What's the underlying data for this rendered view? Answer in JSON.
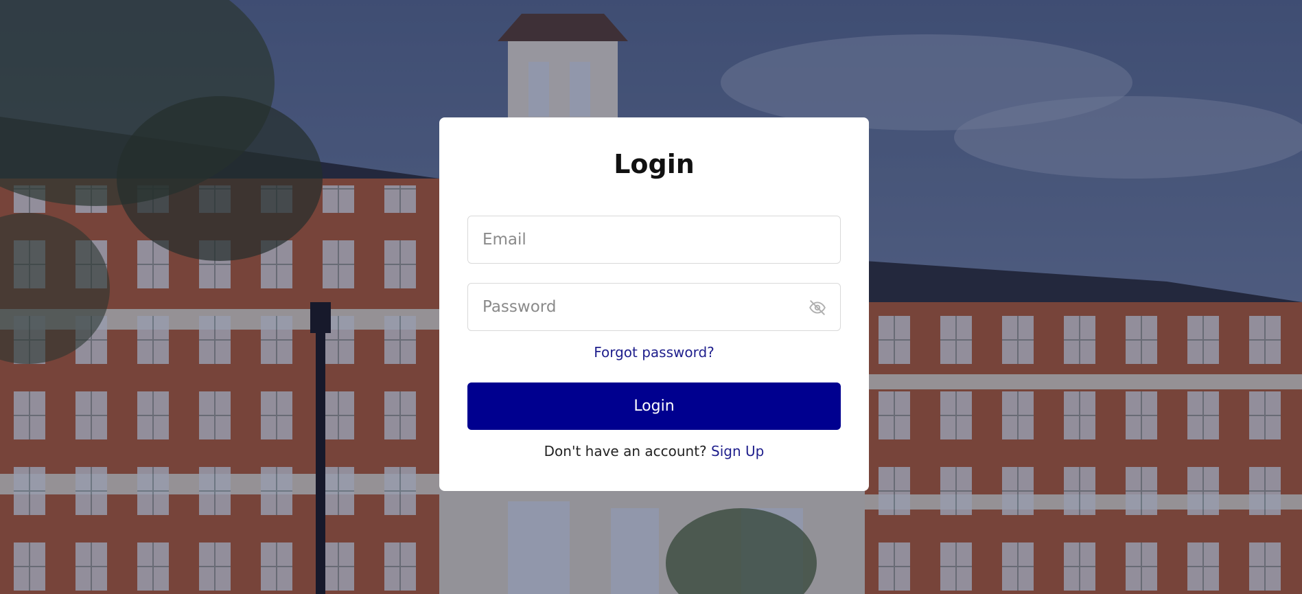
{
  "card": {
    "title": "Login",
    "email_placeholder": "Email",
    "password_placeholder": "Password",
    "password_toggle_icon": "eye-off-icon",
    "forgot_password_link": "Forgot password?",
    "login_button": "Login",
    "signup_prompt": "Don't have an account?",
    "signup_link": "Sign Up"
  },
  "colors": {
    "primary": "#00008f",
    "link": "#1e1e8c",
    "card_bg": "#ffffff"
  }
}
